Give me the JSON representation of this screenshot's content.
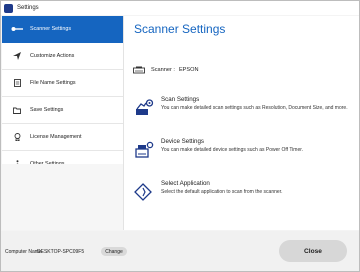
{
  "window": {
    "title": "Settings"
  },
  "sidebar": {
    "items": [
      {
        "label": "Scanner Settings",
        "icon": "scanner-settings-icon",
        "active": true
      },
      {
        "label": "Customize Actions",
        "icon": "send-icon",
        "active": false
      },
      {
        "label": "File Name Settings",
        "icon": "document-icon",
        "active": false
      },
      {
        "label": "Save Settings",
        "icon": "folder-icon",
        "active": false
      },
      {
        "label": "License Management",
        "icon": "license-icon",
        "active": false
      },
      {
        "label": "Other Settings",
        "icon": "more-vertical-icon",
        "active": false
      }
    ]
  },
  "main": {
    "title": "Scanner Settings",
    "scanner_label": "Scanner :",
    "scanner_value": "EPSON",
    "features": [
      {
        "name": "Scan Settings",
        "desc": "You can make detailed scan settings such as Resolution, Document Size, and more."
      },
      {
        "name": "Device Settings",
        "desc": "You can make detailed device settings such as Power Off Timer."
      },
      {
        "name": "Select Application",
        "desc": "Select the default application to scan from the scanner."
      }
    ]
  },
  "footer": {
    "computer_name_label": "Computer Name",
    "computer_name_value": "DESKTOP-SPC09F5",
    "change_label": "Change",
    "close_label": "Close"
  },
  "colors": {
    "accent": "#1565c0"
  }
}
